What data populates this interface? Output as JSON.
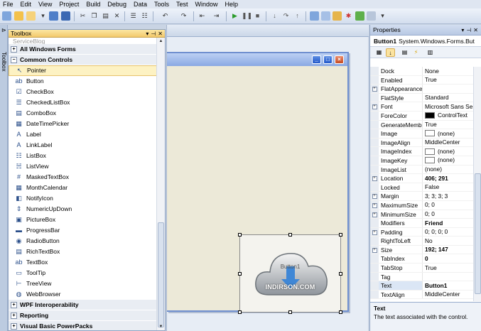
{
  "menu": [
    "File",
    "Edit",
    "View",
    "Project",
    "Build",
    "Debug",
    "Data",
    "Tools",
    "Test",
    "Window",
    "Help"
  ],
  "toolbar_icons": [
    "new-project-icon",
    "open-icon",
    "add-item-icon",
    "save-icon",
    "save-all-icon",
    "cut-icon",
    "copy-icon",
    "paste-icon",
    "undo-icon",
    "redo-icon",
    "start-debug-icon",
    "pause-icon",
    "stop-icon",
    "align-icon",
    "format-icon"
  ],
  "left_strip": {
    "label": "Toolbox"
  },
  "toolbox": {
    "title": "Toolbox",
    "top_cut_item": "ServiceBlog",
    "categories_before": [
      {
        "label": "All Windows Forms",
        "expander": "+"
      },
      {
        "label": "Common Controls",
        "expander": "−"
      }
    ],
    "items": [
      {
        "label": "Pointer",
        "icon": "pointer-icon",
        "glyph": "↖",
        "selected": true
      },
      {
        "label": "Button",
        "icon": "button-icon",
        "glyph": "ab"
      },
      {
        "label": "CheckBox",
        "icon": "checkbox-icon",
        "glyph": "☑"
      },
      {
        "label": "CheckedListBox",
        "icon": "checkedlistbox-icon",
        "glyph": "☰"
      },
      {
        "label": "ComboBox",
        "icon": "combobox-icon",
        "glyph": "▤"
      },
      {
        "label": "DateTimePicker",
        "icon": "datetimepicker-icon",
        "glyph": "▦"
      },
      {
        "label": "Label",
        "icon": "label-icon",
        "glyph": "A"
      },
      {
        "label": "LinkLabel",
        "icon": "linklabel-icon",
        "glyph": "A"
      },
      {
        "label": "ListBox",
        "icon": "listbox-icon",
        "glyph": "☷"
      },
      {
        "label": "ListView",
        "icon": "listview-icon",
        "glyph": "☵"
      },
      {
        "label": "MaskedTextBox",
        "icon": "maskedtextbox-icon",
        "glyph": "#"
      },
      {
        "label": "MonthCalendar",
        "icon": "monthcalendar-icon",
        "glyph": "▦"
      },
      {
        "label": "NotifyIcon",
        "icon": "notifyicon-icon",
        "glyph": "◧"
      },
      {
        "label": "NumericUpDown",
        "icon": "numericupdown-icon",
        "glyph": "⇕"
      },
      {
        "label": "PictureBox",
        "icon": "picturebox-icon",
        "glyph": "▣"
      },
      {
        "label": "ProgressBar",
        "icon": "progressbar-icon",
        "glyph": "▬"
      },
      {
        "label": "RadioButton",
        "icon": "radiobutton-icon",
        "glyph": "◉"
      },
      {
        "label": "RichTextBox",
        "icon": "richtextbox-icon",
        "glyph": "▤"
      },
      {
        "label": "TextBox",
        "icon": "textbox-icon",
        "glyph": "ab"
      },
      {
        "label": "ToolTip",
        "icon": "tooltip-icon",
        "glyph": "▭"
      },
      {
        "label": "TreeView",
        "icon": "treeview-icon",
        "glyph": "⊢"
      },
      {
        "label": "WebBrowser",
        "icon": "webbrowser-icon",
        "glyph": "◍"
      }
    ],
    "categories_after": [
      {
        "label": "WPF Interoperability",
        "expander": "+"
      },
      {
        "label": "Reporting",
        "expander": "+"
      },
      {
        "label": "Visual Basic PowerPacks",
        "expander": "+"
      },
      {
        "label": "General",
        "expander": "−"
      }
    ]
  },
  "designer": {
    "button_text": "Button1",
    "watermark": "INDIRSON.COM",
    "window_buttons": [
      "_",
      "□",
      "×"
    ]
  },
  "properties": {
    "title": "Properties",
    "object_name": "Button1",
    "object_type": "System.Windows.Forms.But",
    "rows": [
      {
        "name": "Dock",
        "value": "None"
      },
      {
        "name": "Enabled",
        "value": "True"
      },
      {
        "name": "FlatAppearance",
        "value": "",
        "expander": "+"
      },
      {
        "name": "FlatStyle",
        "value": "Standard"
      },
      {
        "name": "Font",
        "value": "Microsoft Sans Se",
        "expander": "+"
      },
      {
        "name": "ForeColor",
        "value": "ControlText",
        "swatch": "#000000"
      },
      {
        "name": "GenerateMembe",
        "value": "True"
      },
      {
        "name": "Image",
        "value": "(none)",
        "swatch": "#ffffff"
      },
      {
        "name": "ImageAlign",
        "value": "MiddleCenter"
      },
      {
        "name": "ImageIndex",
        "value": "(none)",
        "swatch": "#ffffff"
      },
      {
        "name": "ImageKey",
        "value": "(none)",
        "swatch": "#ffffff"
      },
      {
        "name": "ImageList",
        "value": "(none)"
      },
      {
        "name": "Location",
        "value": "406; 291",
        "expander": "+",
        "bold": true
      },
      {
        "name": "Locked",
        "value": "False"
      },
      {
        "name": "Margin",
        "value": "3; 3; 3; 3",
        "expander": "+"
      },
      {
        "name": "MaximumSize",
        "value": "0; 0",
        "expander": "+"
      },
      {
        "name": "MinimumSize",
        "value": "0; 0",
        "expander": "+"
      },
      {
        "name": "Modifiers",
        "value": "Friend",
        "bold": true
      },
      {
        "name": "Padding",
        "value": "0; 0; 0; 0",
        "expander": "+"
      },
      {
        "name": "RightToLeft",
        "value": "No"
      },
      {
        "name": "Size",
        "value": "192; 147",
        "expander": "+",
        "bold": true
      },
      {
        "name": "TabIndex",
        "value": "0",
        "bold": true
      },
      {
        "name": "TabStop",
        "value": "True"
      },
      {
        "name": "Tag",
        "value": ""
      },
      {
        "name": "Text",
        "value": "Button1",
        "bold": true,
        "selected": true
      },
      {
        "name": "TextAlign",
        "value": "MiddleCenter"
      }
    ],
    "description": {
      "title": "Text",
      "body": "The text associated with the control."
    }
  },
  "colors": {
    "selection_gold": "#fdf2c3",
    "form_back": "#ece9d8",
    "titlebar_blue": "#8aa9e3"
  }
}
